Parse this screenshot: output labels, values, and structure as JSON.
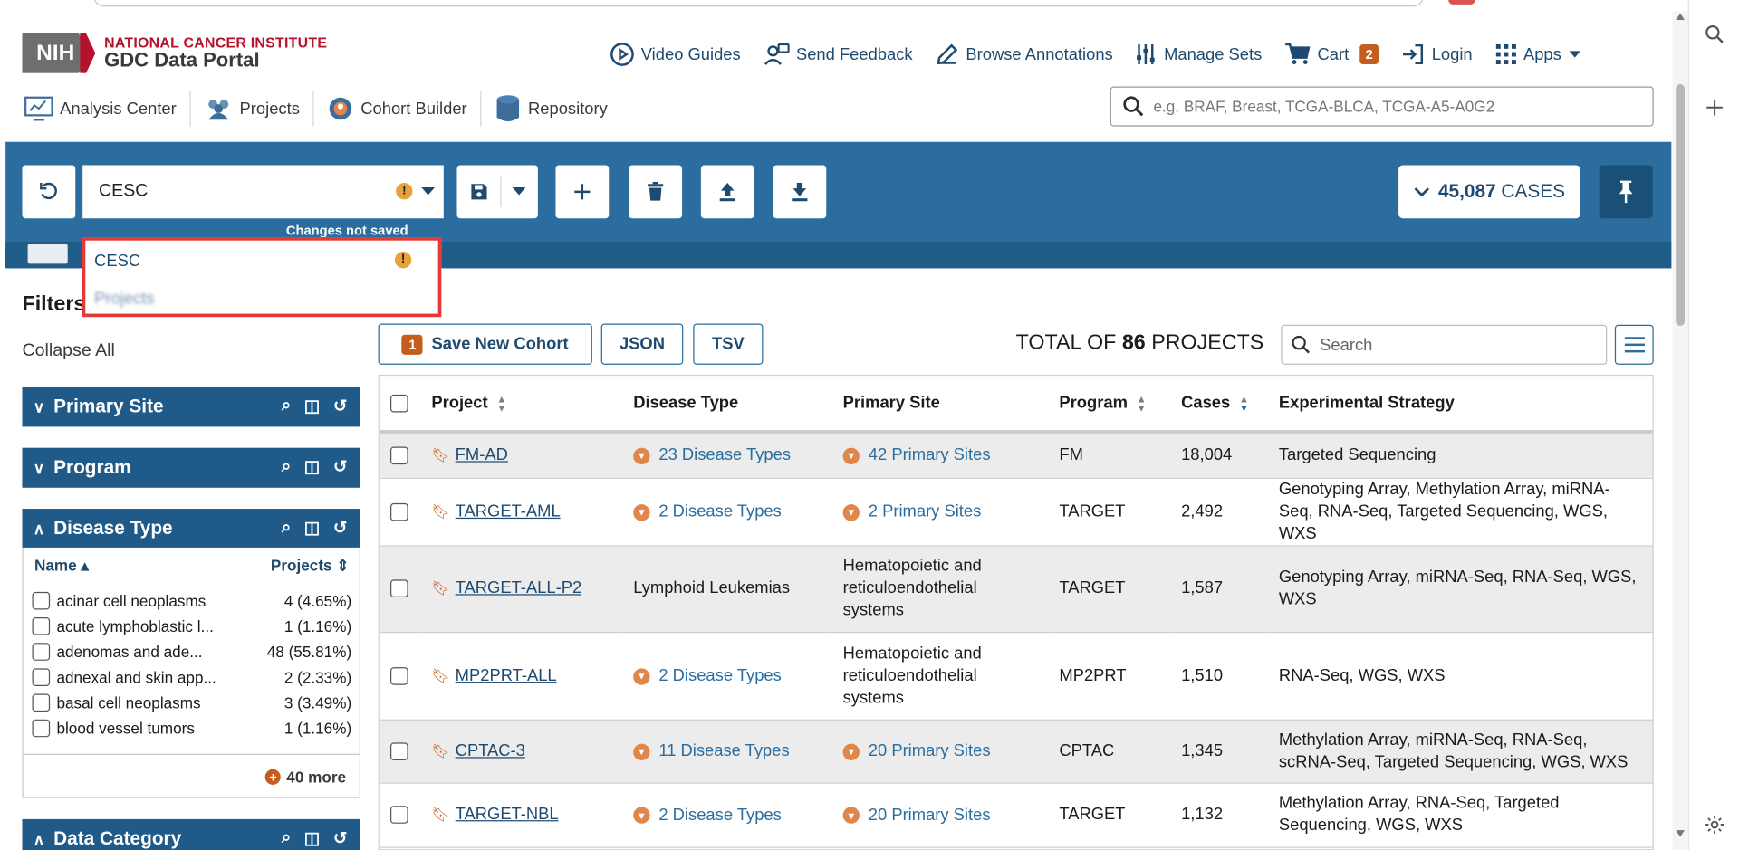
{
  "header": {
    "institute": "NATIONAL CANCER INSTITUTE",
    "portal": "GDC Data Portal",
    "logo_text": "NIH",
    "nav": [
      {
        "label": "Video Guides",
        "icon": "play-circle-icon"
      },
      {
        "label": "Send Feedback",
        "icon": "feedback-icon"
      },
      {
        "label": "Browse Annotations",
        "icon": "pencil-icon"
      },
      {
        "label": "Manage Sets",
        "icon": "sliders-icon"
      },
      {
        "label": "Cart",
        "icon": "cart-icon",
        "badge": "2"
      },
      {
        "label": "Login",
        "icon": "login-icon"
      },
      {
        "label": "Apps",
        "icon": "grid-icon"
      }
    ],
    "subnav": [
      {
        "label": "Analysis Center",
        "icon": "analysis-icon"
      },
      {
        "label": "Projects",
        "icon": "people-icon"
      },
      {
        "label": "Cohort Builder",
        "icon": "cohort-icon"
      },
      {
        "label": "Repository",
        "icon": "database-icon"
      }
    ],
    "search_placeholder": "e.g. BRAF, Breast, TCGA-BLCA, TCGA-A5-A0G2"
  },
  "cohort_bar": {
    "cohort_name": "CESC",
    "changes_note": "Changes not saved",
    "cases_count": "45,087",
    "cases_label": "CASES"
  },
  "dropdown": {
    "options": [
      "CESC",
      "Projects"
    ]
  },
  "filters": {
    "title": "Filters",
    "collapse_all": "Collapse All",
    "facets": [
      "Primary Site",
      "Program",
      "Disease Type",
      "Data Category"
    ],
    "disease_type": {
      "col_name": "Name",
      "col_projects": "Projects",
      "rows": [
        {
          "name": "acinar cell neoplasms",
          "count": "4 (4.65%)"
        },
        {
          "name": "acute lymphoblastic l...",
          "count": "1 (1.16%)"
        },
        {
          "name": "adenomas and ade...",
          "count": "48 (55.81%)"
        },
        {
          "name": "adnexal and skin app...",
          "count": "2 (2.33%)"
        },
        {
          "name": "basal cell neoplasms",
          "count": "3 (3.49%)"
        },
        {
          "name": "blood vessel tumors",
          "count": "1 (1.16%)"
        }
      ],
      "more": "40 more"
    }
  },
  "toolbar": {
    "save_count": "1",
    "save_label": "Save New Cohort",
    "json_label": "JSON",
    "tsv_label": "TSV",
    "total_prefix": "TOTAL OF",
    "total_count": "86",
    "total_suffix": "PROJECTS",
    "search_placeholder": "Search"
  },
  "table": {
    "columns": [
      "Project",
      "Disease Type",
      "Primary Site",
      "Program",
      "Cases",
      "Experimental Strategy"
    ],
    "rows": [
      {
        "project": "FM-AD",
        "disease": "23 Disease Types",
        "disease_expand": true,
        "site": "42 Primary Sites",
        "site_expand": true,
        "program": "FM",
        "cases": "18,004",
        "strategy": "Targeted Sequencing"
      },
      {
        "project": "TARGET-AML",
        "disease": "2 Disease Types",
        "disease_expand": true,
        "site": "2 Primary Sites",
        "site_expand": true,
        "program": "TARGET",
        "cases": "2,492",
        "strategy": "Genotyping Array, Methylation Array, miRNA-Seq, RNA-Seq, Targeted Sequencing, WGS, WXS"
      },
      {
        "project": "TARGET-ALL-P2",
        "disease": "Lymphoid Leukemias",
        "disease_expand": false,
        "site": "Hematopoietic and reticuloendothelial systems",
        "site_expand": false,
        "program": "TARGET",
        "cases": "1,587",
        "strategy": "Genotyping Array, miRNA-Seq, RNA-Seq, WGS, WXS"
      },
      {
        "project": "MP2PRT-ALL",
        "disease": "2 Disease Types",
        "disease_expand": true,
        "site": "Hematopoietic and reticuloendothelial systems",
        "site_expand": false,
        "program": "MP2PRT",
        "cases": "1,510",
        "strategy": "RNA-Seq, WGS, WXS"
      },
      {
        "project": "CPTAC-3",
        "disease": "11 Disease Types",
        "disease_expand": true,
        "site": "20 Primary Sites",
        "site_expand": true,
        "program": "CPTAC",
        "cases": "1,345",
        "strategy": "Methylation Array, miRNA-Seq, RNA-Seq, scRNA-Seq, Targeted Sequencing, WGS, WXS"
      },
      {
        "project": "TARGET-NBL",
        "disease": "2 Disease Types",
        "disease_expand": true,
        "site": "20 Primary Sites",
        "site_expand": true,
        "program": "TARGET",
        "cases": "1,132",
        "strategy": "Methylation Array, RNA-Seq, Targeted Sequencing, WGS, WXS"
      }
    ]
  },
  "colors": {
    "primary_blue": "#2a6d9e",
    "dark_blue": "#1f5a89",
    "accent_orange": "#c55e1c",
    "nih_red": "#b5122b",
    "highlight_red": "#e53935"
  }
}
